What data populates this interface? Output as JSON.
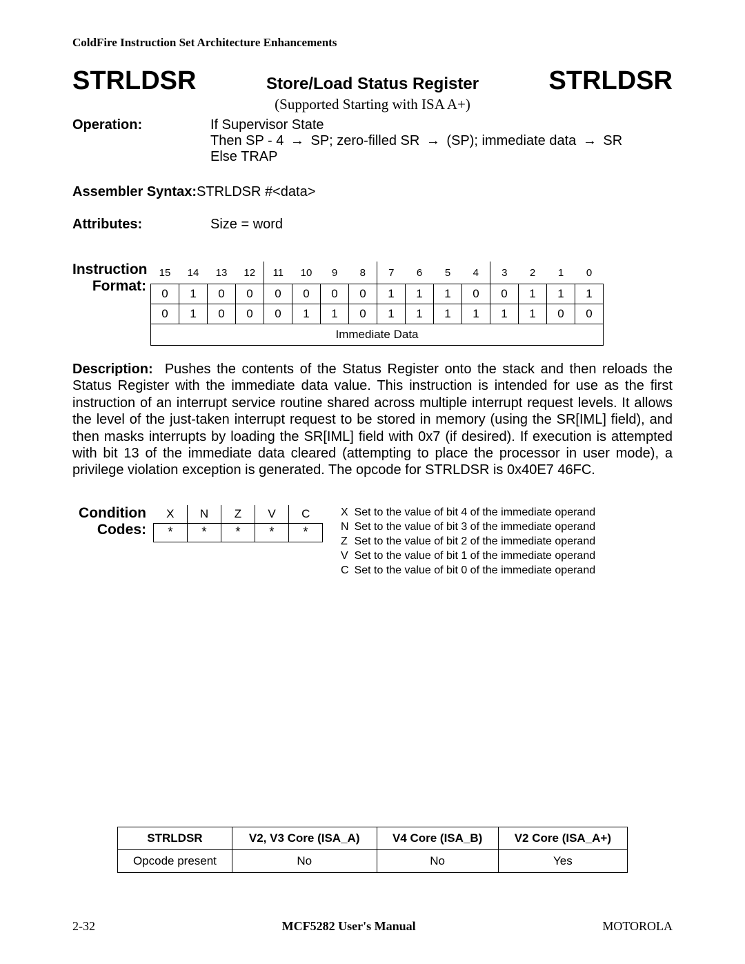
{
  "header": "ColdFire Instruction Set Architecture Enhancements",
  "title": {
    "left": "STRLDSR",
    "center": "Store/Load Status Register",
    "right": "STRLDSR",
    "sub": "(Supported Starting with ISA A+)"
  },
  "operation": {
    "label": "Operation:",
    "line1": "If Supervisor State",
    "line2a": "Then SP - 4 ",
    "line2b": " SP; zero-filled SR ",
    "line2c": " (SP); immediate data ",
    "line2d": " SR",
    "line3": "Else TRAP"
  },
  "asm": {
    "label": "Assembler Syntax:",
    "value": "STRLDSR #<data>"
  },
  "attr": {
    "label": "Attributes:",
    "value": "Size = word"
  },
  "fmt": {
    "label1": "Instruction",
    "label2": "Format:",
    "bits": [
      "15",
      "14",
      "13",
      "12",
      "11",
      "10",
      "9",
      "8",
      "7",
      "6",
      "5",
      "4",
      "3",
      "2",
      "1",
      "0"
    ],
    "row1": [
      "0",
      "1",
      "0",
      "0",
      "0",
      "0",
      "0",
      "0",
      "1",
      "1",
      "1",
      "0",
      "0",
      "1",
      "1",
      "1"
    ],
    "row2": [
      "0",
      "1",
      "0",
      "0",
      "0",
      "1",
      "1",
      "0",
      "1",
      "1",
      "1",
      "1",
      "1",
      "1",
      "0",
      "0"
    ],
    "imm": "Immediate Data"
  },
  "desc": {
    "label": "Description:",
    "body": "Pushes the contents of the Status Register onto the stack and then reloads the Status Register with the immediate data value. This instruction is intended for use as the first instruction of an interrupt service routine shared across multiple interrupt request levels. It allows the level of the just-taken interrupt request to be stored in memory (using the SR[IML] field), and then masks interrupts by loading the SR[IML] field with 0x7 (if desired). If execution is attempted with bit 13 of the immediate data cleared (attempting to place the processor in user mode), a privilege violation exception is generated. The opcode for STRLDSR is 0x40E7 46FC."
  },
  "cc": {
    "label1": "Condition",
    "label2": "Codes:",
    "flags": [
      "X",
      "N",
      "Z",
      "V",
      "C"
    ],
    "vals": [
      "*",
      "*",
      "*",
      "*",
      "*"
    ],
    "explain": [
      [
        "X",
        "Set to the value of bit 4 of the immediate operand"
      ],
      [
        "N",
        "Set to the value of bit 3 of the immediate operand"
      ],
      [
        "Z",
        "Set to the value of bit 2 of the immediate operand"
      ],
      [
        "V",
        "Set to the value of bit 1 of the immediate operand"
      ],
      [
        "C",
        "Set to the value of bit 0 of the immediate operand"
      ]
    ]
  },
  "support": {
    "head": [
      "STRLDSR",
      "V2, V3 Core (ISA_A)",
      "V4 Core (ISA_B)",
      "V2 Core (ISA_A+)"
    ],
    "row_label": "Opcode present",
    "row_vals": [
      "No",
      "No",
      "Yes"
    ]
  },
  "footer": {
    "left": "2-32",
    "center": "MCF5282 User's Manual",
    "right": "MOTOROLA"
  }
}
